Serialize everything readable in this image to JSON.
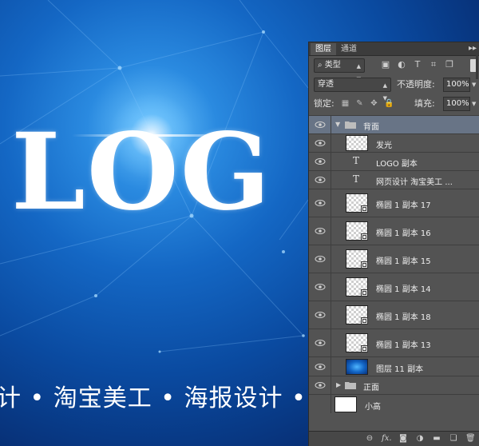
{
  "canvas": {
    "logo_text": "LOG",
    "tagline": "计 • 淘宝美工 • 海报设计 • 名"
  },
  "panel": {
    "tabs": [
      "图层",
      "通道"
    ],
    "tab_menu": "▸▸",
    "kind_filter": "类型",
    "blend_mode": "穿透",
    "opacity_label": "不透明度:",
    "opacity_value": "100%",
    "lock_label": "锁定:",
    "fill_label": "填充:",
    "fill_value": "100%",
    "layers": [
      {
        "name": "背面",
        "type": "group",
        "expanded": true
      },
      {
        "name": "发光",
        "type": "pixel"
      },
      {
        "name": "LOGO 副本",
        "type": "text"
      },
      {
        "name": "网页设计  淘宝美工  ...",
        "type": "text"
      },
      {
        "name": "椭圆 1 副本 17",
        "type": "shape"
      },
      {
        "name": "椭圆 1 副本 16",
        "type": "shape"
      },
      {
        "name": "椭圆 1 副本 15",
        "type": "shape"
      },
      {
        "name": "椭圆 1 副本 14",
        "type": "shape"
      },
      {
        "name": "椭圆 1 副本 18",
        "type": "shape"
      },
      {
        "name": "椭圆 1 副本 13",
        "type": "shape"
      },
      {
        "name": "图层 11 副本",
        "type": "pixel"
      },
      {
        "name": "正面",
        "type": "group",
        "expanded": false
      },
      {
        "name": "小高",
        "type": "pixel"
      }
    ],
    "bottom_icons": [
      "link-icon",
      "fx-icon",
      "mask-icon",
      "adjustment-icon",
      "new-group-icon",
      "new-layer-icon",
      "trash-icon"
    ],
    "bottom_labels": {
      "fx": "fx."
    },
    "colors": {
      "panel_bg": "#535353",
      "selected": "#687486"
    }
  }
}
